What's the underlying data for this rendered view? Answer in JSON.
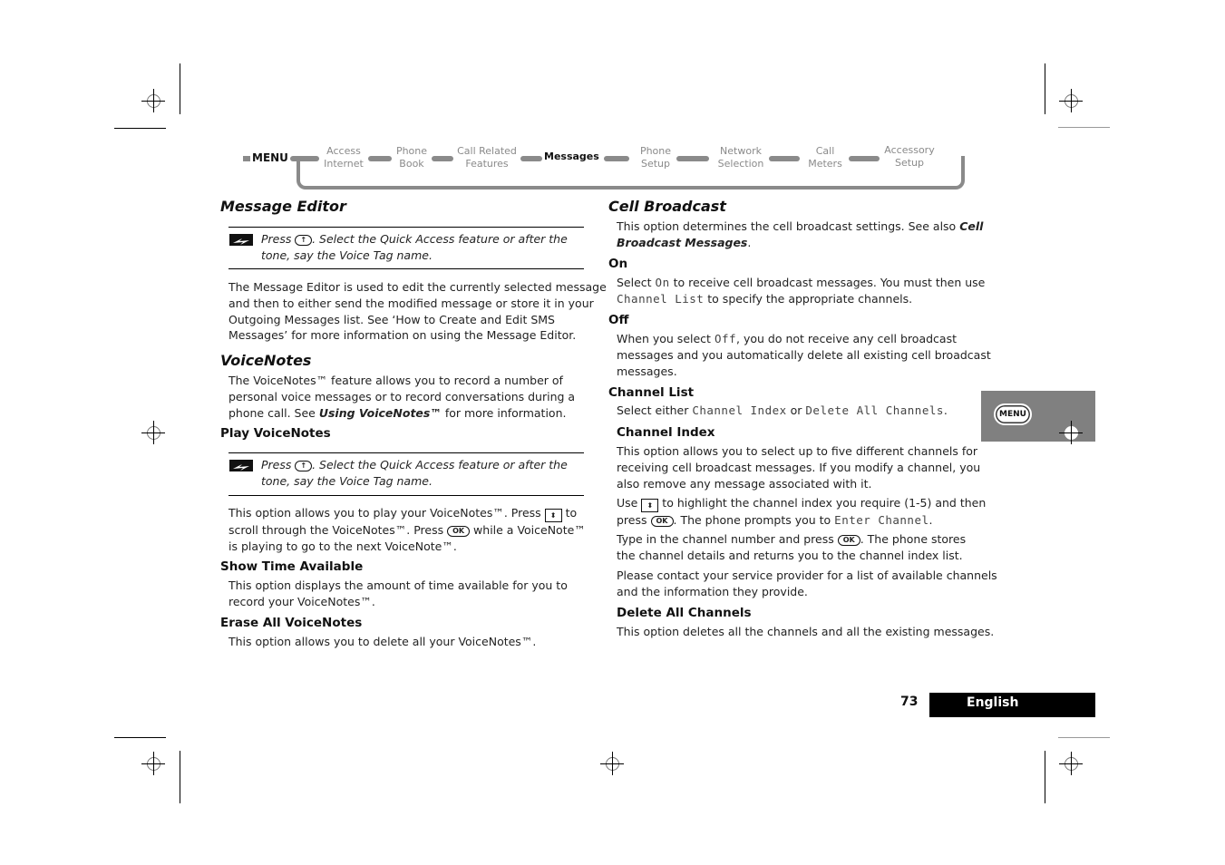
{
  "nav": {
    "menu_label": "MENU",
    "items": [
      {
        "line1": "Access",
        "line2": "Internet"
      },
      {
        "line1": "Phone",
        "line2": "Book"
      },
      {
        "line1": "Call Related",
        "line2": "Features"
      },
      {
        "line1": "Messages",
        "line2": ""
      },
      {
        "line1": "Phone",
        "line2": "Setup"
      },
      {
        "line1": "Network",
        "line2": "Selection"
      },
      {
        "line1": "Call",
        "line2": "Meters"
      },
      {
        "line1": "Accessory",
        "line2": "Setup"
      }
    ],
    "active": "Messages",
    "track_color": "#8a8a8a"
  },
  "left": {
    "message_editor": {
      "title": "Message Editor",
      "note": {
        "press": "Press",
        "key": "↑",
        "rest1": ". Select the Quick Access feature or after the",
        "rest2": "tone, say the Voice Tag name."
      },
      "body": [
        "The Message Editor is used to edit the currently selected message",
        "and then to either send the modified message or store it in your",
        "Outgoing Messages list. See ‘How to Create and Edit SMS",
        "Messages’ for more information on using the Message Editor."
      ]
    },
    "voicenotes": {
      "title": "VoiceNotes",
      "body1": "The VoiceNotes™ feature allows you to record a number of",
      "body2": "personal voice messages or to record conversations during a",
      "body3_pre": "phone call. See ",
      "body3_link": "Using VoiceNotes™",
      "body3_post": " for more information."
    },
    "play": {
      "title": "Play VoiceNotes",
      "note": {
        "press": "Press",
        "key": "↑",
        "rest1": ". Select the Quick Access feature or after the",
        "rest2": "tone, say the Voice Tag name."
      },
      "l1_pre": "This option allows you to play your VoiceNotes™. Press ",
      "l1_post": " to",
      "l2_pre": "scroll through the VoiceNotes™. Press ",
      "ok": "OK",
      "l2_post": " while a VoiceNote™",
      "l3": "is playing to go to the next VoiceNote™."
    },
    "show_time": {
      "title": "Show Time Available",
      "body": [
        "This option displays the amount of time available for you to",
        "record your VoiceNotes™."
      ]
    },
    "erase": {
      "title": "Erase All VoiceNotes",
      "body": "This option allows you to delete all your VoiceNotes™."
    }
  },
  "right": {
    "cell": {
      "title": "Cell Broadcast",
      "l1_pre": "This option determines the cell broadcast settings. See also ",
      "l1_link": "Cell",
      "l2_link": "Broadcast Messages",
      "l2_post": "."
    },
    "on": {
      "title": "On",
      "l1_pre": "Select ",
      "l1_mono": "On",
      "l1_post": " to receive cell broadcast messages. You must then use",
      "l2_mono": "Channel List",
      "l2_post": " to specify the appropriate channels."
    },
    "off": {
      "title": "Off",
      "l1_pre": "When you select ",
      "l1_mono": "Off",
      "l1_post": ", you do not receive any cell broadcast",
      "l2": "messages and you automatically delete all existing cell broadcast",
      "l3": "messages."
    },
    "channel_list": {
      "title": "Channel List",
      "pre": "Select either ",
      "mono1": "Channel Index",
      "mid": " or ",
      "mono2": "Delete All Channels",
      "post": "."
    },
    "channel_index": {
      "title": "Channel Index",
      "p1": [
        "This option allows you to select up to five different channels for",
        "receiving cell broadcast messages. If you modify a channel, you",
        "also remove any message associated with it."
      ],
      "p2_l1_pre": "Use ",
      "p2_l1_post": " to highlight the channel index you require (1-5) and then",
      "p2_l2_pre": "press ",
      "ok": "OK",
      "p2_l2_mid": ". The phone prompts you to ",
      "p2_l2_mono": "Enter Channel",
      "p2_l2_post": ".",
      "p3_l1_pre": "Type in the channel number and press ",
      "p3_l1_post": ". The phone stores",
      "p3_l2": "the channel details and returns you to the channel index list.",
      "p4": [
        "Please contact your service provider for a list of available channels",
        "and the information they provide."
      ]
    },
    "delete_all": {
      "title": "Delete All Channels",
      "body": "This option deletes all the channels and all the existing messages."
    }
  },
  "side_tab": {
    "label": "MENU",
    "color": "#808080"
  },
  "footer": {
    "page_number": "73",
    "language": "English"
  }
}
